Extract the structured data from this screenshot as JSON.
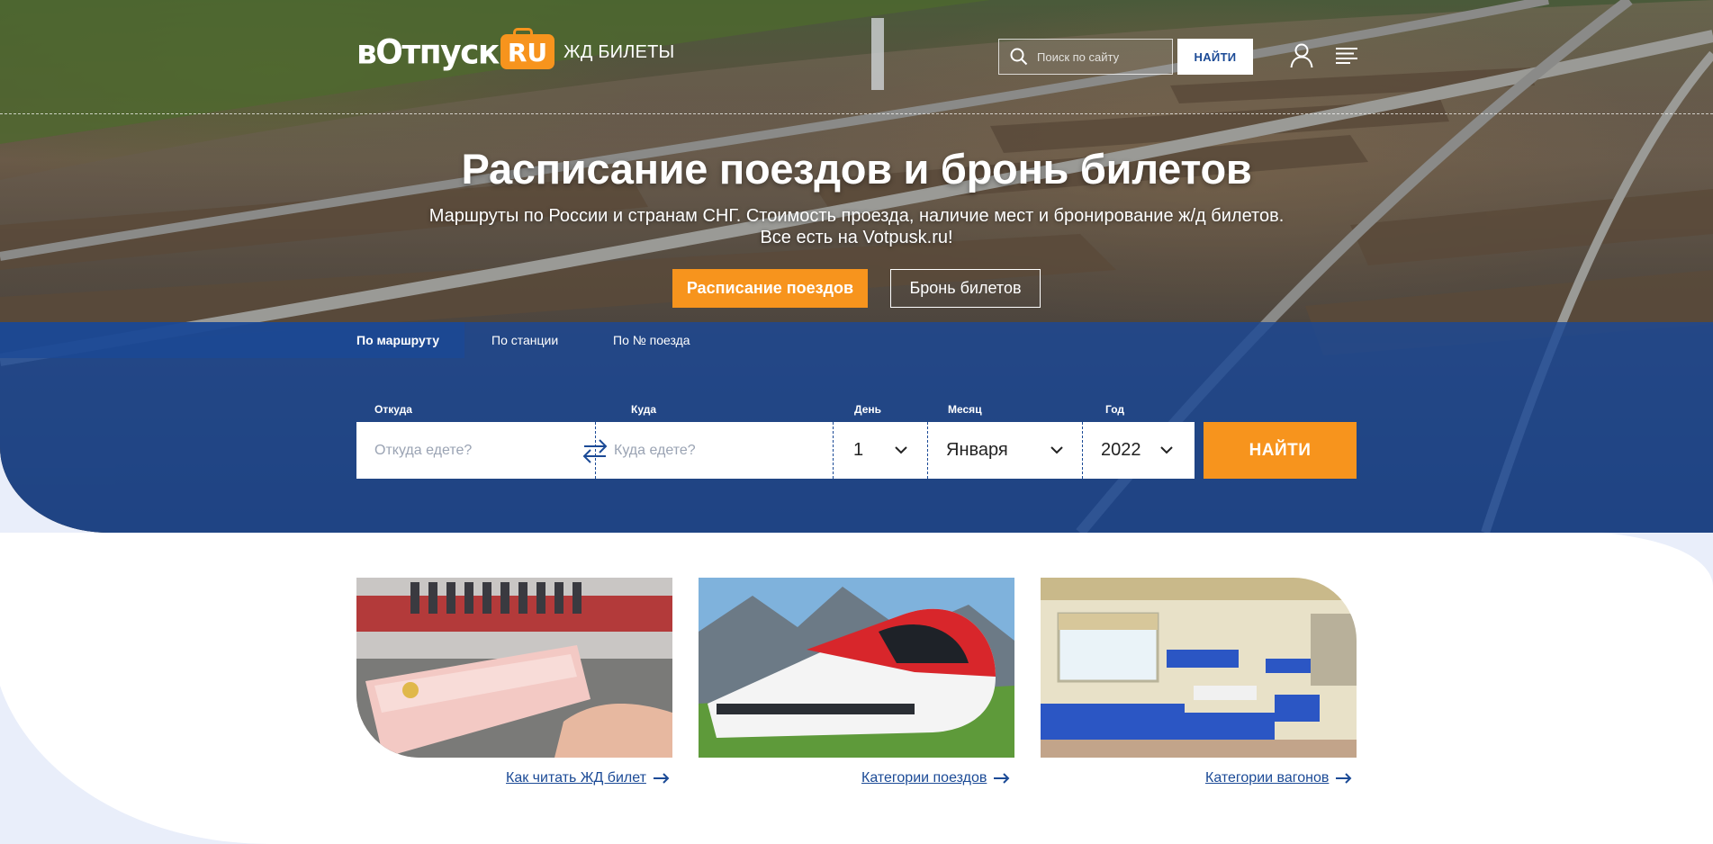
{
  "header": {
    "logo_word": "вОтпуск",
    "logo_badge": "RU",
    "logo_sub": "ЖД БИЛЕТЫ",
    "search_placeholder": "Поиск по сайту",
    "search_button": "НАЙТИ",
    "icons": {
      "search": "search-icon",
      "user": "user-icon",
      "menu": "menu-icon"
    }
  },
  "hero": {
    "title": "Расписание поездов и бронь билетов",
    "subtitle_line1": "Маршруты по России и странам СНГ. Стоимость проезда, наличие мест и бронирование ж/д билетов.",
    "subtitle_line2": "Все есть на Votpusk.ru!",
    "btn_schedule": "Расписание поездов",
    "btn_booking": "Бронь билетов"
  },
  "search": {
    "tabs": [
      {
        "label": "По маршруту",
        "active": true
      },
      {
        "label": "По станции",
        "active": false
      },
      {
        "label": "По № поезда",
        "active": false
      }
    ],
    "from_label": "Откуда",
    "from_placeholder": "Откуда едете?",
    "to_label": "Куда",
    "to_placeholder": "Куда едете?",
    "day_label": "День",
    "day_value": "1",
    "month_label": "Месяц",
    "month_value": "Января",
    "year_label": "Год",
    "year_value": "2022",
    "find_button": "НАЙТИ"
  },
  "cards": [
    {
      "link": "Как читать ЖД билет"
    },
    {
      "link": "Категории поездов"
    },
    {
      "link": "Категории вагонов"
    }
  ],
  "colors": {
    "accent": "#f7941d",
    "brand_blue": "#1b4a96",
    "page_bg": "#e9eefa"
  }
}
